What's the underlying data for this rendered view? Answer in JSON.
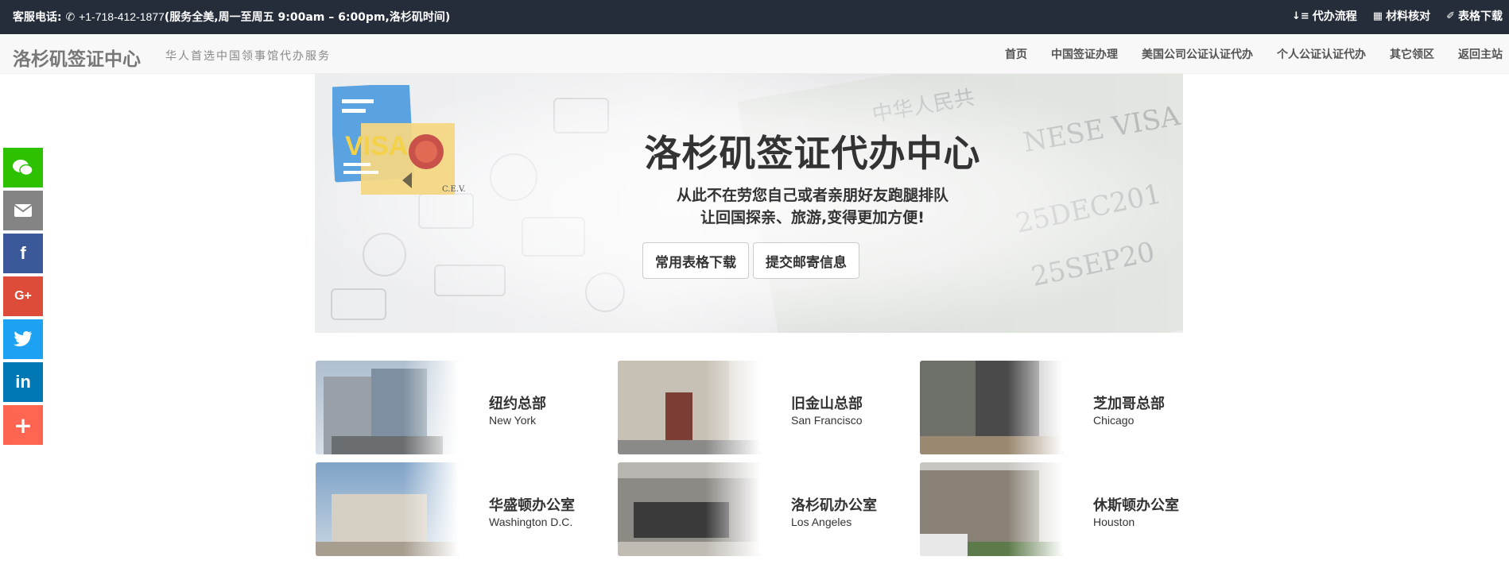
{
  "topbar": {
    "phone_label": "客服电话:",
    "phone_number": "+1-718-412-1877",
    "phone_note": "(服务全美,周一至周五 9:00am – 6:00pm,洛杉矶时间)",
    "links": [
      {
        "label": "代办流程",
        "icon": "sort-icon"
      },
      {
        "label": "材料核对",
        "icon": "checklist-icon"
      },
      {
        "label": "表格下载",
        "icon": "paperclip-icon"
      }
    ]
  },
  "navbar": {
    "brand": "洛杉矶签证中心",
    "tagline": "华人首选中国领事馆代办服务",
    "items": [
      "首页",
      "中国签证办理",
      "美国公司公证认证代办",
      "个人公证认证代办",
      "其它领区",
      "返回主站"
    ]
  },
  "hero": {
    "title": "洛杉矶签证代办中心",
    "subtitle_line1": "从此不在劳您自己或者亲朋好友跑腿排队",
    "subtitle_line2": "让回国探亲、旅游,变得更加方便!",
    "btn_forms": "常用表格下载",
    "btn_mail": "提交邮寄信息",
    "logo_text": "VISA",
    "logo_sub": "C.E.V."
  },
  "share": [
    {
      "icon": "wechat-icon",
      "color": "#2dc100"
    },
    {
      "icon": "email-icon",
      "color": "#848484"
    },
    {
      "icon": "facebook-icon",
      "color": "#3b5998"
    },
    {
      "icon": "google-plus-icon",
      "color": "#dd4b39"
    },
    {
      "icon": "twitter-icon",
      "color": "#1da1f2"
    },
    {
      "icon": "linkedin-icon",
      "color": "#0077b5"
    },
    {
      "icon": "more-plus-icon",
      "color": "#ff6550"
    }
  ],
  "offices": [
    {
      "name": "纽约总部",
      "en": "New York"
    },
    {
      "name": "旧金山总部",
      "en": "San Francisco"
    },
    {
      "name": "芝加哥总部",
      "en": "Chicago"
    },
    {
      "name": "华盛顿办公室",
      "en": "Washington D.C."
    },
    {
      "name": "洛杉矶办公室",
      "en": "Los Angeles"
    },
    {
      "name": "休斯顿办公室",
      "en": "Houston"
    }
  ]
}
